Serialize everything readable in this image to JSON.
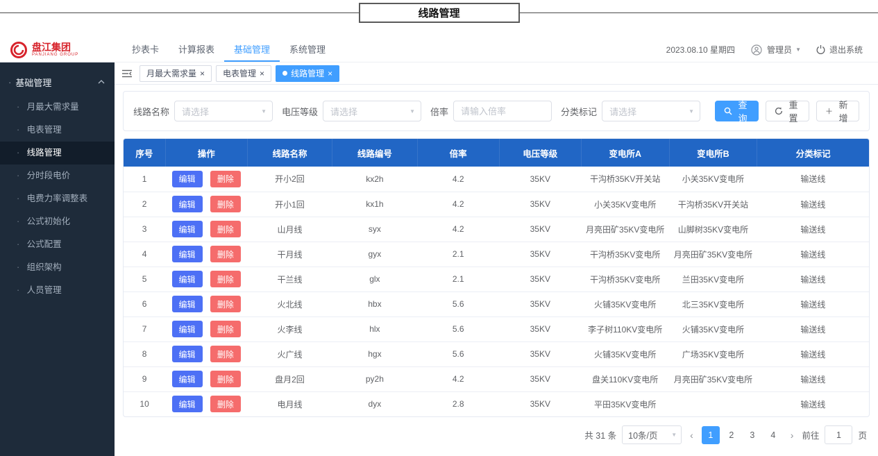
{
  "annotation": {
    "title": "线路管理"
  },
  "icons": {
    "close": "×",
    "caret_down": "▼",
    "prev": "‹",
    "next": "›",
    "plus": "＋"
  },
  "header": {
    "logo_text": "盘江集团",
    "logo_subtext": "PANJIANG GROUP",
    "nav": [
      {
        "label": "抄表卡",
        "active": false
      },
      {
        "label": "计算报表",
        "active": false
      },
      {
        "label": "基础管理",
        "active": true
      },
      {
        "label": "系统管理",
        "active": false
      }
    ],
    "date": "2023.08.10 星期四",
    "user": "管理员",
    "logout": "退出系统"
  },
  "sidebar": {
    "group_label": "基础管理",
    "items": [
      {
        "label": "月最大需求量",
        "active": false
      },
      {
        "label": "电表管理",
        "active": false
      },
      {
        "label": "线路管理",
        "active": true
      },
      {
        "label": "分时段电价",
        "active": false
      },
      {
        "label": "电费力率调整表",
        "active": false
      },
      {
        "label": "公式初始化",
        "active": false
      },
      {
        "label": "公式配置",
        "active": false
      },
      {
        "label": "组织架构",
        "active": false
      },
      {
        "label": "人员管理",
        "active": false
      }
    ]
  },
  "tabs": [
    {
      "label": "月最大需求量",
      "active": false
    },
    {
      "label": "电表管理",
      "active": false
    },
    {
      "label": "线路管理",
      "active": true
    }
  ],
  "filters": {
    "line_name_label": "线路名称",
    "line_name_placeholder": "请选择",
    "voltage_label": "电压等级",
    "voltage_placeholder": "请选择",
    "ratio_label": "倍率",
    "ratio_placeholder": "请输入倍率",
    "category_label": "分类标记",
    "category_placeholder": "请选择",
    "search_button": "查询",
    "reset_button": "重置",
    "add_button": "新增"
  },
  "table": {
    "headers": [
      "序号",
      "操作",
      "线路名称",
      "线路编号",
      "倍率",
      "电压等级",
      "变电所A",
      "变电所B",
      "分类标记"
    ],
    "edit_label": "编辑",
    "delete_label": "删除",
    "rows": [
      {
        "index": "1",
        "name": "开小2回",
        "code": "kx2h",
        "ratio": "4.2",
        "voltage": "35KV",
        "station_a": "干沟桥35KV开关站",
        "station_b": "小关35KV变电所",
        "category": "输送线"
      },
      {
        "index": "2",
        "name": "开小1回",
        "code": "kx1h",
        "ratio": "4.2",
        "voltage": "35KV",
        "station_a": "小关35KV变电所",
        "station_b": "干沟桥35KV开关站",
        "category": "输送线"
      },
      {
        "index": "3",
        "name": "山月线",
        "code": "syx",
        "ratio": "4.2",
        "voltage": "35KV",
        "station_a": "月亮田矿35KV变电所",
        "station_b": "山脚树35KV变电所",
        "category": "输送线"
      },
      {
        "index": "4",
        "name": "干月线",
        "code": "gyx",
        "ratio": "2.1",
        "voltage": "35KV",
        "station_a": "干沟桥35KV变电所",
        "station_b": "月亮田矿35KV变电所",
        "category": "输送线"
      },
      {
        "index": "5",
        "name": "干兰线",
        "code": "glx",
        "ratio": "2.1",
        "voltage": "35KV",
        "station_a": "干沟桥35KV变电所",
        "station_b": "兰田35KV变电所",
        "category": "输送线"
      },
      {
        "index": "6",
        "name": "火北线",
        "code": "hbx",
        "ratio": "5.6",
        "voltage": "35KV",
        "station_a": "火铺35KV变电所",
        "station_b": "北三35KV变电所",
        "category": "输送线"
      },
      {
        "index": "7",
        "name": "火李线",
        "code": "hlx",
        "ratio": "5.6",
        "voltage": "35KV",
        "station_a": "李子树110KV变电所",
        "station_b": "火铺35KV变电所",
        "category": "输送线"
      },
      {
        "index": "8",
        "name": "火广线",
        "code": "hgx",
        "ratio": "5.6",
        "voltage": "35KV",
        "station_a": "火铺35KV变电所",
        "station_b": "广场35KV变电所",
        "category": "输送线"
      },
      {
        "index": "9",
        "name": "盘月2回",
        "code": "py2h",
        "ratio": "4.2",
        "voltage": "35KV",
        "station_a": "盘关110KV变电所",
        "station_b": "月亮田矿35KV变电所",
        "category": "输送线"
      },
      {
        "index": "10",
        "name": "电月线",
        "code": "dyx",
        "ratio": "2.8",
        "voltage": "35KV",
        "station_a": "平田35KV变电所",
        "station_b": "",
        "category": "输送线"
      }
    ]
  },
  "pagination": {
    "total_text": "共 31 条",
    "page_size": "10条/页",
    "pages": [
      "1",
      "2",
      "3",
      "4"
    ],
    "current_page": "1",
    "goto_label": "前往",
    "goto_value": "1",
    "goto_suffix": "页"
  }
}
